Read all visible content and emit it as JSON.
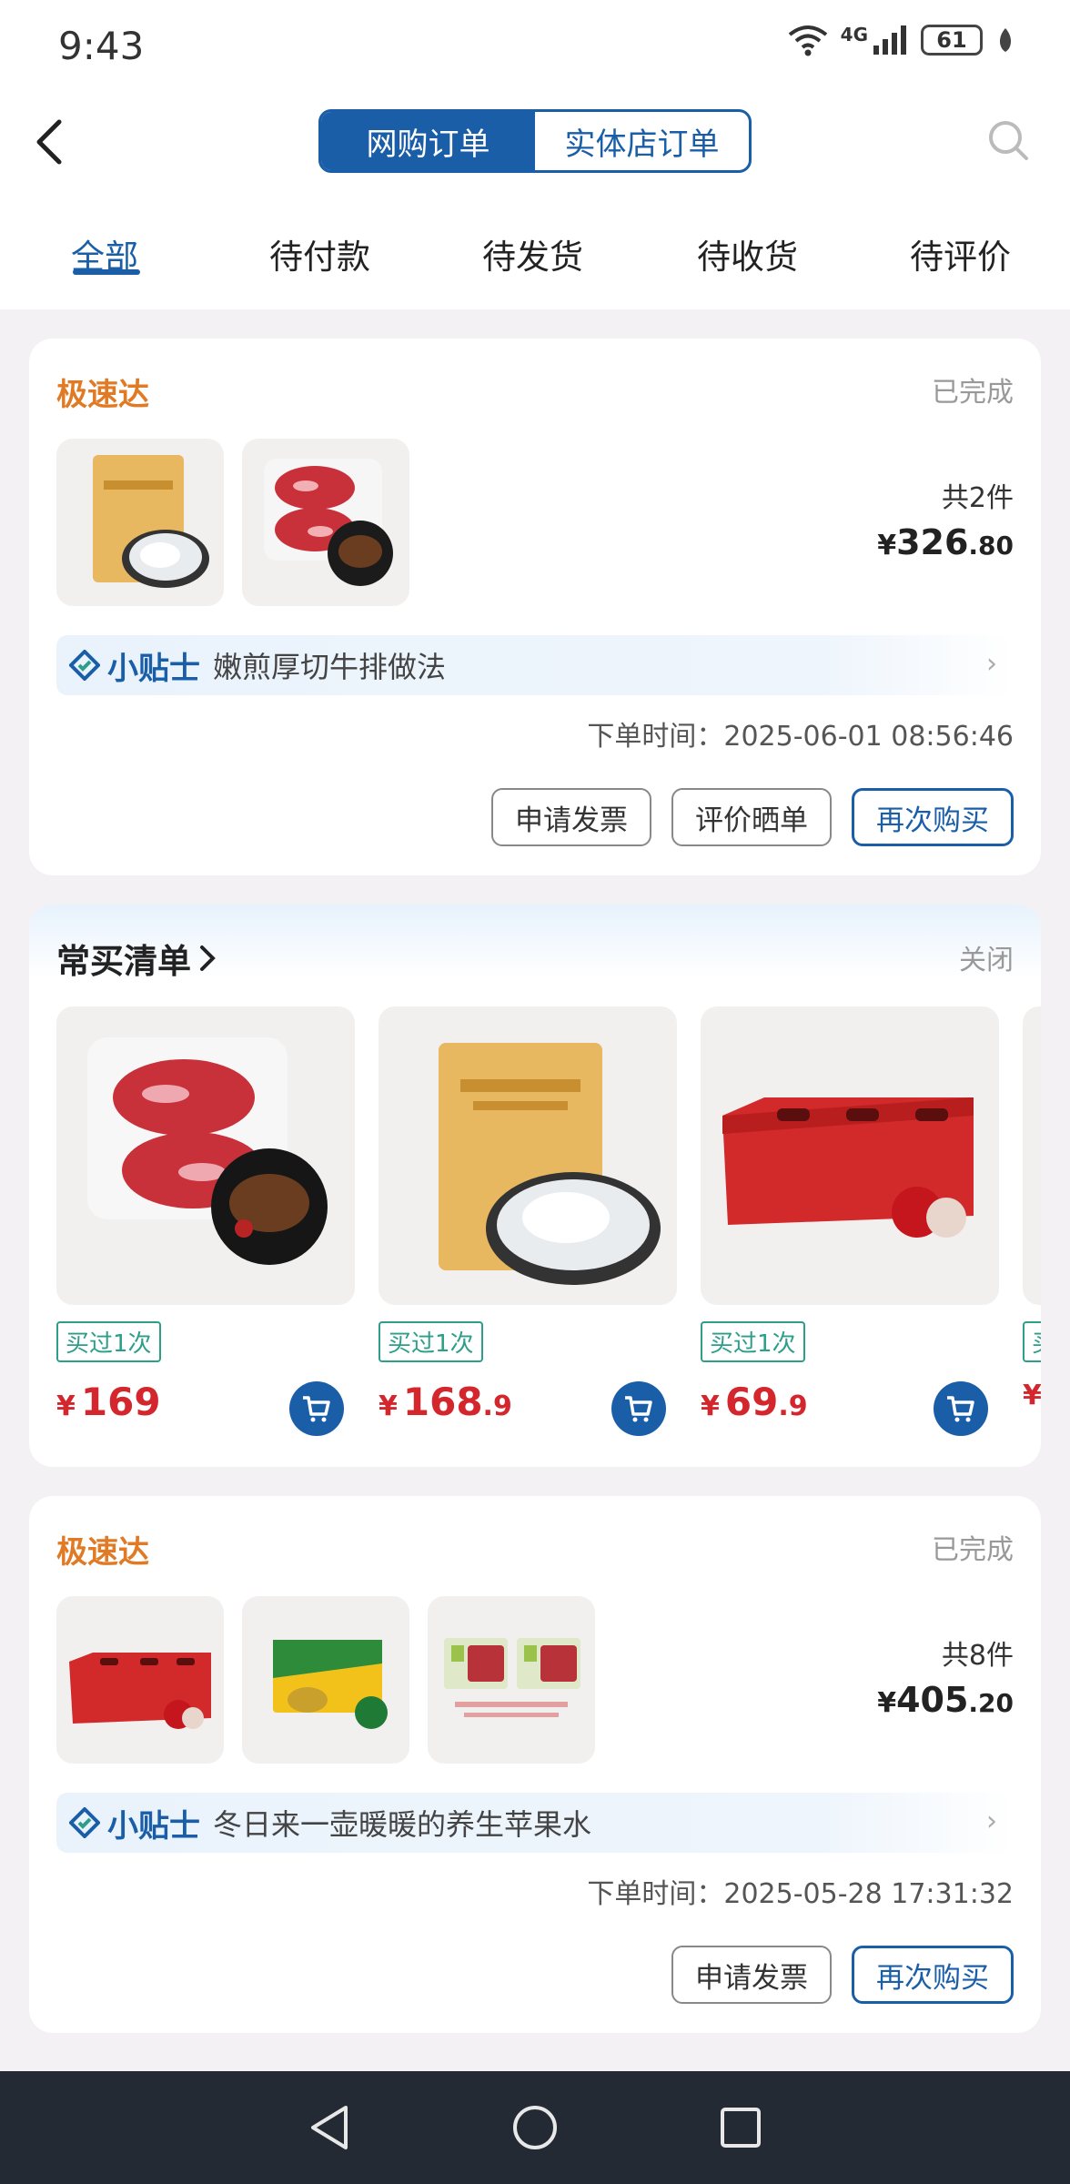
{
  "status_bar": {
    "time": "9:43",
    "network": "4G",
    "battery": "61"
  },
  "header": {
    "segments": [
      "网购订单",
      "实体店订单"
    ],
    "active_segment": 0,
    "tabs": [
      "全部",
      "待付款",
      "待发货",
      "待收货",
      "待评价"
    ],
    "active_tab": 0
  },
  "orders": [
    {
      "brand": "极速达",
      "status": "已完成",
      "count": "共2件",
      "total_currency": "¥",
      "total_int": "326",
      "total_dec": ".80",
      "tips_label": "小贴士",
      "tips_text": "嫩煎厚切牛排做法",
      "order_time": "下单时间：2025-06-01 08:56:46",
      "buttons": [
        "申请发票",
        "评价晒单",
        "再次购买"
      ]
    },
    {
      "brand": "极速达",
      "status": "已完成",
      "count": "共8件",
      "total_currency": "¥",
      "total_int": "405",
      "total_dec": ".20",
      "tips_label": "小贴士",
      "tips_text": "冬日来一壶暖暖的养生苹果水",
      "order_time": "下单时间：2025-05-28 17:31:32",
      "buttons": [
        "申请发票",
        "再次购买"
      ]
    }
  ],
  "frequent_list": {
    "title": "常买清单",
    "close": "关闭",
    "items": [
      {
        "tag": "买过1次",
        "currency": "¥",
        "price_int": "169",
        "price_dec": ""
      },
      {
        "tag": "买过1次",
        "currency": "¥",
        "price_int": "168",
        "price_dec": ".9"
      },
      {
        "tag": "买过1次",
        "currency": "¥",
        "price_int": "69",
        "price_dec": ".9"
      },
      {
        "tag": "买",
        "currency": "¥",
        "price_int": "",
        "price_dec": ""
      }
    ]
  },
  "colors": {
    "primary": "#1a5ea8",
    "brand_orange": "#e07a24",
    "price_red": "#d4262d",
    "tag_green": "#2c9e8a"
  }
}
